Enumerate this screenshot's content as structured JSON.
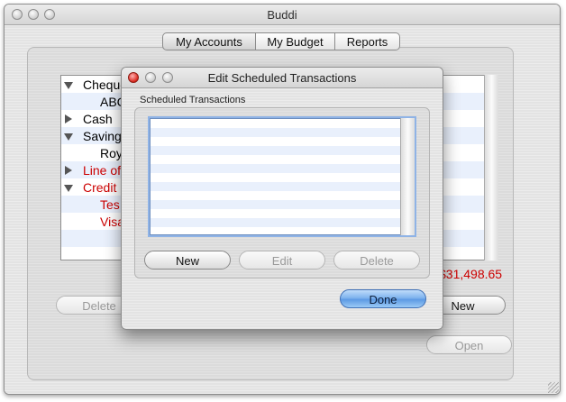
{
  "window": {
    "title": "Buddi"
  },
  "tabs": [
    {
      "label": "My Accounts",
      "selected": true
    },
    {
      "label": "My Budget",
      "selected": false
    },
    {
      "label": "Reports",
      "selected": false
    }
  ],
  "accounts_tree": [
    {
      "label": "Cheque",
      "expanded": true,
      "color": "#000000"
    },
    {
      "label": "ABC",
      "color": "#000000"
    },
    {
      "label": "Cash",
      "expanded": false,
      "color": "#000000"
    },
    {
      "label": "Saving",
      "expanded": true,
      "color": "#000000"
    },
    {
      "label": "Roy",
      "color": "#000000"
    },
    {
      "label": "Line of",
      "expanded": false,
      "color": "#cc0000"
    },
    {
      "label": "Credit",
      "expanded": true,
      "color": "#cc0000"
    },
    {
      "label": "Tes",
      "color": "#cc0000"
    },
    {
      "label": "Visa",
      "color": "#cc0000"
    }
  ],
  "net_worth": "$31,498.65",
  "main_buttons": {
    "delete": "Delete",
    "new": "New",
    "open": "Open"
  },
  "dialog": {
    "title": "Edit Scheduled Transactions",
    "group_label": "Scheduled Transactions",
    "buttons": {
      "new": "New",
      "edit": "Edit",
      "delete": "Delete",
      "done": "Done"
    },
    "list_items": []
  },
  "colors": {
    "negative": "#cc0000",
    "accent_blue": "#5d9ae4",
    "list_stripe": "#e9f0fc"
  }
}
